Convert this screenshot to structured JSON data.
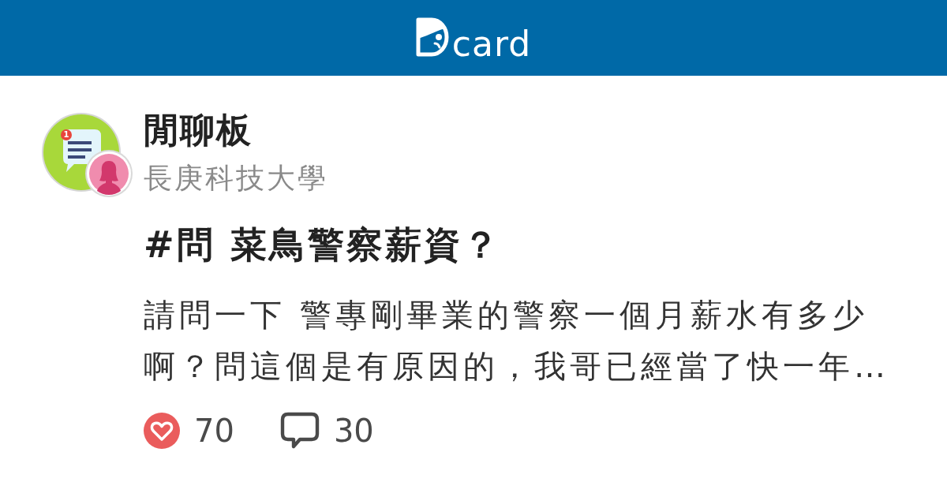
{
  "header": {
    "logo_text": "card"
  },
  "forum": {
    "name": "閒聊板",
    "school": "長庚科技大學",
    "badge": "1"
  },
  "post": {
    "title": "#問 菜鳥警察薪資？",
    "excerpt": "請問一下 警專剛畢業的警察一個月薪水有多少啊？問這個是有原因的，我哥已經當了快一年…"
  },
  "stats": [
    {
      "kind": "likes",
      "count": "70"
    },
    {
      "kind": "comments",
      "count": "30"
    }
  ]
}
